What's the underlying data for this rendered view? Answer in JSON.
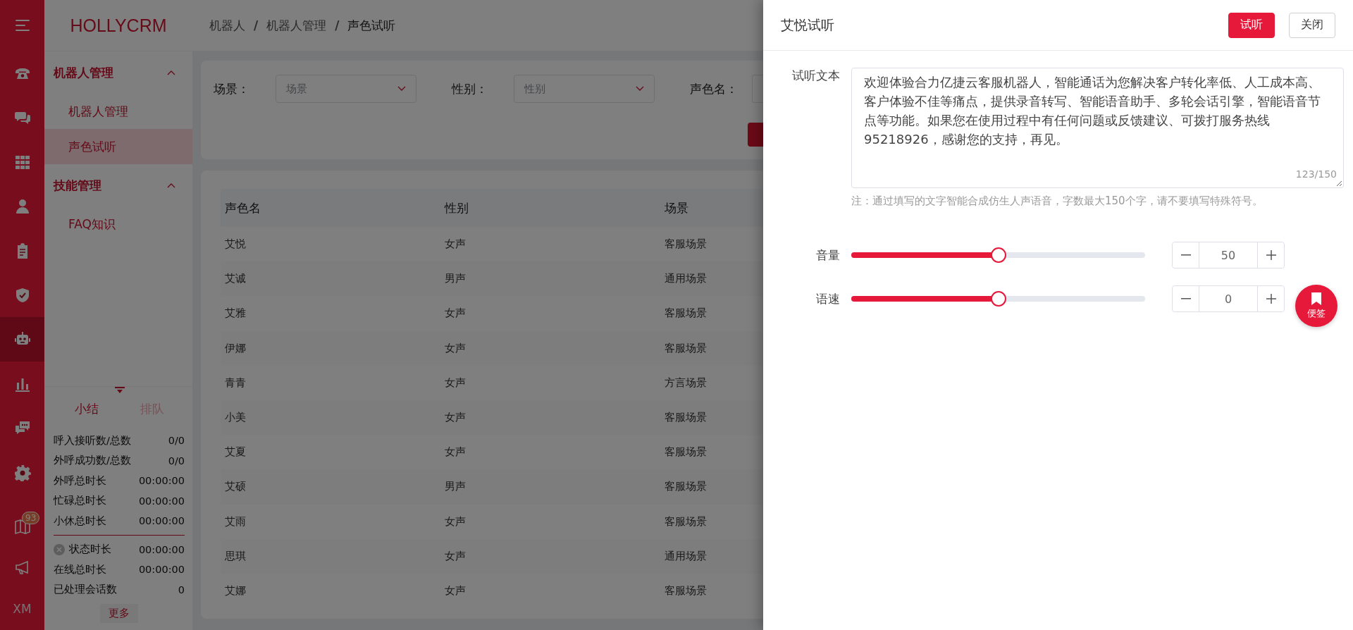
{
  "rail": {
    "items": [
      {
        "kind": "menu",
        "selected": false
      },
      {
        "kind": "phone",
        "selected": false
      },
      {
        "kind": "chat",
        "selected": false
      },
      {
        "kind": "grid",
        "selected": false
      },
      {
        "kind": "person",
        "selected": false
      },
      {
        "kind": "clipboard",
        "selected": false
      },
      {
        "kind": "shield",
        "selected": false
      },
      {
        "kind": "robot",
        "selected": true
      },
      {
        "kind": "chart",
        "selected": false
      },
      {
        "kind": "comment",
        "selected": false
      },
      {
        "kind": "gear",
        "selected": false
      }
    ],
    "bottom": [
      {
        "kind": "book",
        "badge": "93"
      },
      {
        "kind": "megaphone"
      }
    ],
    "user": "XM"
  },
  "sidebar": {
    "logo": "HOLLYCRM",
    "groups": [
      {
        "label": "机器人管理",
        "expanded": true,
        "children": [
          {
            "label": "机器人管理",
            "selected": false
          },
          {
            "label": "声色试听",
            "selected": true
          }
        ]
      },
      {
        "label": "技能管理",
        "expanded": true,
        "children": [
          {
            "label": "FAQ知识",
            "selected": false
          }
        ]
      }
    ]
  },
  "stats": {
    "tabs": [
      {
        "label": "小结",
        "selected": true
      },
      {
        "label": "排队",
        "selected": false
      }
    ],
    "rows": [
      {
        "kind": "plain",
        "label": "呼入接听数/总数",
        "value": "0/0"
      },
      {
        "kind": "plain",
        "label": "外呼成功数/总数",
        "value": "0/0"
      },
      {
        "kind": "plain",
        "label": "外呼总时长",
        "value": "00:00:00"
      },
      {
        "kind": "plain",
        "label": "忙碌总时长",
        "value": "00:00:00"
      },
      {
        "kind": "plain",
        "label": "小休总时长",
        "value": "00:00:00"
      },
      {
        "kind": "divider"
      },
      {
        "kind": "status",
        "label": "状态时长",
        "value": "00:00:00"
      },
      {
        "kind": "plain",
        "label": "在线总时长",
        "value": "00:00:00"
      },
      {
        "kind": "plain",
        "label": "已处理会话数",
        "value": "0"
      }
    ],
    "more": "更多"
  },
  "breadcrumb": {
    "separator": "/",
    "items": [
      "机器人",
      "机器人管理",
      "声色试听"
    ]
  },
  "filters": [
    {
      "kind": "select",
      "label": "场景：",
      "placeholder": "场景"
    },
    {
      "kind": "select",
      "label": "性别：",
      "placeholder": "性别"
    },
    {
      "kind": "input",
      "label": "声色名："
    }
  ],
  "table": {
    "columns": [
      "声色名",
      "性别",
      "场景"
    ],
    "rows": [
      [
        "艾悦",
        "女声",
        "客服场景"
      ],
      [
        "艾诚",
        "男声",
        "通用场景"
      ],
      [
        "艾雅",
        "女声",
        "客服场景"
      ],
      [
        "伊娜",
        "女声",
        "客服场景"
      ],
      [
        "青青",
        "女声",
        "方言场景"
      ],
      [
        "小美",
        "女声",
        "客服场景"
      ],
      [
        "艾夏",
        "女声",
        "客服场景"
      ],
      [
        "艾硕",
        "男声",
        "客服场景"
      ],
      [
        "艾雨",
        "女声",
        "客服场景"
      ],
      [
        "思琪",
        "女声",
        "通用场景"
      ],
      [
        "艾娜",
        "女声",
        "客服场景"
      ]
    ]
  },
  "drawer": {
    "title": "艾悦试听",
    "buttons": [
      {
        "label": "试听",
        "kind": "primary"
      },
      {
        "label": "关闭",
        "kind": "default"
      }
    ],
    "text_label": "试听文本",
    "text": "欢迎体验合力亿捷云客服机器人，智能通话为您解决客户转化率低、人工成本高、客户体验不佳等痛点，提供录音转写、智能语音助手、多轮会话引擎，智能语音节点等功能。如果您在使用过程中有任何问题或反馈建议、可拨打服务热线95218926，感谢您的支持，再见。",
    "counter": "123/150",
    "note": "注：通过填写的文字智能合成仿生人声语音，字数最大150个字，请不要填写特殊符号。",
    "sliders": [
      {
        "label": "音量",
        "level": 0.5,
        "value": "50"
      },
      {
        "label": "语速",
        "level": 0.5,
        "value": "0"
      }
    ]
  },
  "float_button": {
    "label": "便签"
  }
}
